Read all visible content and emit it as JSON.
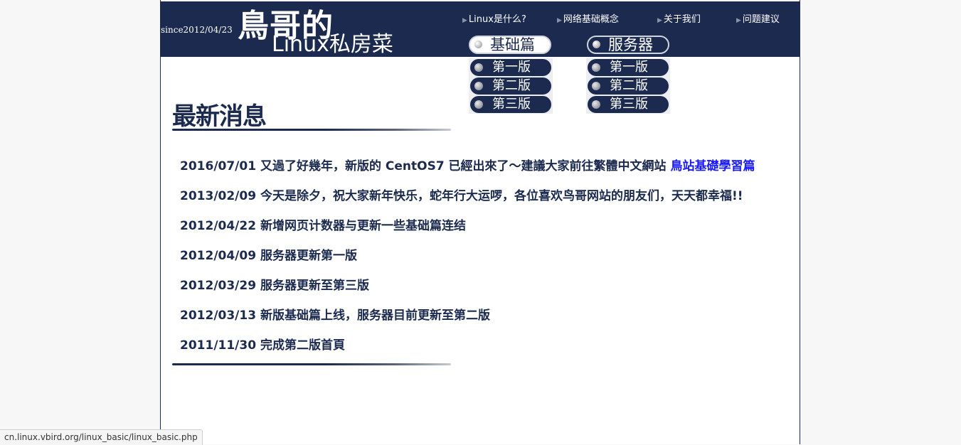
{
  "header": {
    "since": "since2012/04/23",
    "logo_line1": "鳥哥的",
    "logo_line2": "Linux私房菜",
    "nav": [
      {
        "label": "Linux是什么?"
      },
      {
        "label": "网络基础概念"
      },
      {
        "label": "关于我们"
      },
      {
        "label": "问题建议"
      }
    ]
  },
  "categories": [
    {
      "title": "基础篇",
      "versions": [
        "第一版",
        "第二版",
        "第三版"
      ]
    },
    {
      "title": "服务器",
      "versions": [
        "第一版",
        "第二版",
        "第三版"
      ]
    }
  ],
  "news": {
    "title": "最新消息",
    "items": [
      {
        "text": "2016/07/01 又過了好幾年，新版的 CentOS7 已經出來了～建議大家前往繁體中文網站 ",
        "link": "鳥站基礎學習篇"
      },
      {
        "text": "2013/02/09 今天是除夕，祝大家新年快乐，蛇年行大运啰，各位喜欢鸟哥网站的朋友们，天天都幸福!!"
      },
      {
        "text": "2012/04/22 新增网页计数器与更新一些基础篇连结"
      },
      {
        "text": "2012/04/09 服务器更新第一版"
      },
      {
        "text": "2012/03/29 服务器更新至第三版"
      },
      {
        "text": "2012/03/13 新版基础篇上线，服务器目前更新至第二版"
      },
      {
        "text": "2011/11/30 完成第二版首頁"
      }
    ]
  },
  "status_url": "cn.linux.vbird.org/linux_basic/linux_basic.php",
  "colors": {
    "navy": "#1b2a4e",
    "link": "#1a1aff",
    "white": "#ffffff"
  }
}
